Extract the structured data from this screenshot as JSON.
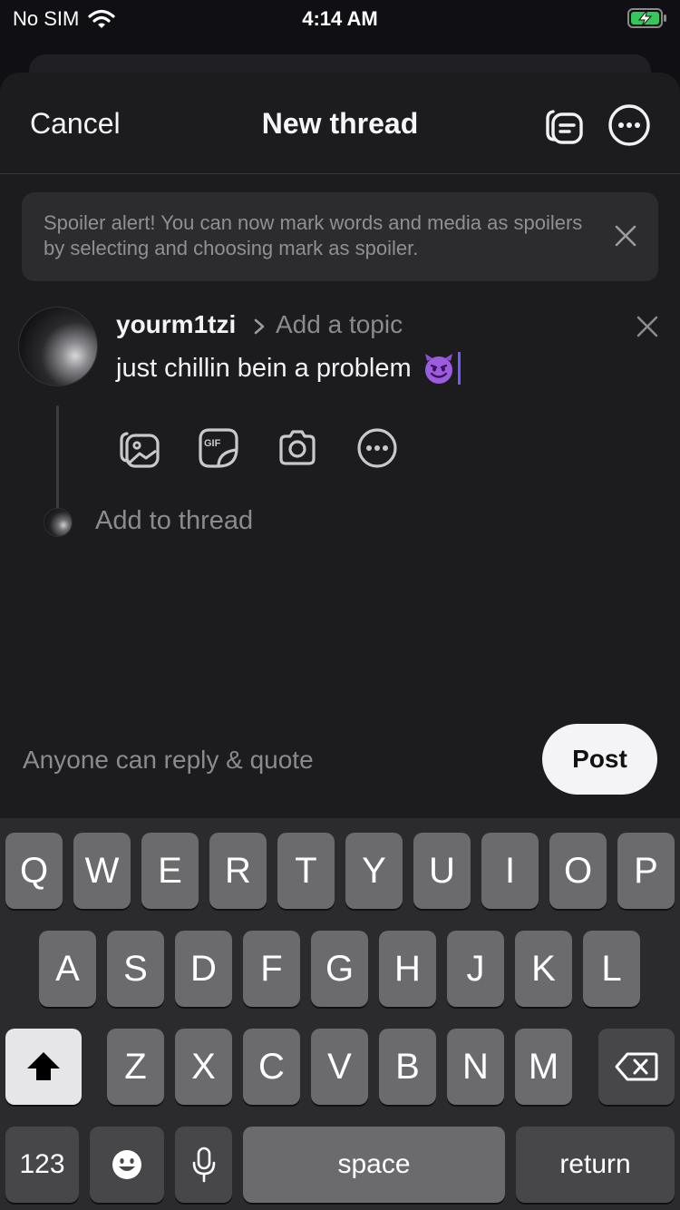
{
  "status_bar": {
    "carrier": "No SIM",
    "time": "4:14 AM"
  },
  "nav": {
    "cancel": "Cancel",
    "title": "New thread"
  },
  "banner": {
    "text": "Spoiler alert! You can now mark words and media as spoilers by selecting and choosing mark as spoiler."
  },
  "post": {
    "username": "yourm1tzi",
    "topic_placeholder": "Add a topic",
    "text": "just chillin bein a problem"
  },
  "add_thread": "Add to thread",
  "reply_setting": "Anyone can reply & quote",
  "post_button": "Post",
  "keyboard": {
    "row1": [
      "Q",
      "W",
      "E",
      "R",
      "T",
      "Y",
      "U",
      "I",
      "O",
      "P"
    ],
    "row2": [
      "A",
      "S",
      "D",
      "F",
      "G",
      "H",
      "J",
      "K",
      "L"
    ],
    "row3": [
      "Z",
      "X",
      "C",
      "V",
      "B",
      "N",
      "M"
    ],
    "numbers": "123",
    "space": "space",
    "return": "return"
  }
}
